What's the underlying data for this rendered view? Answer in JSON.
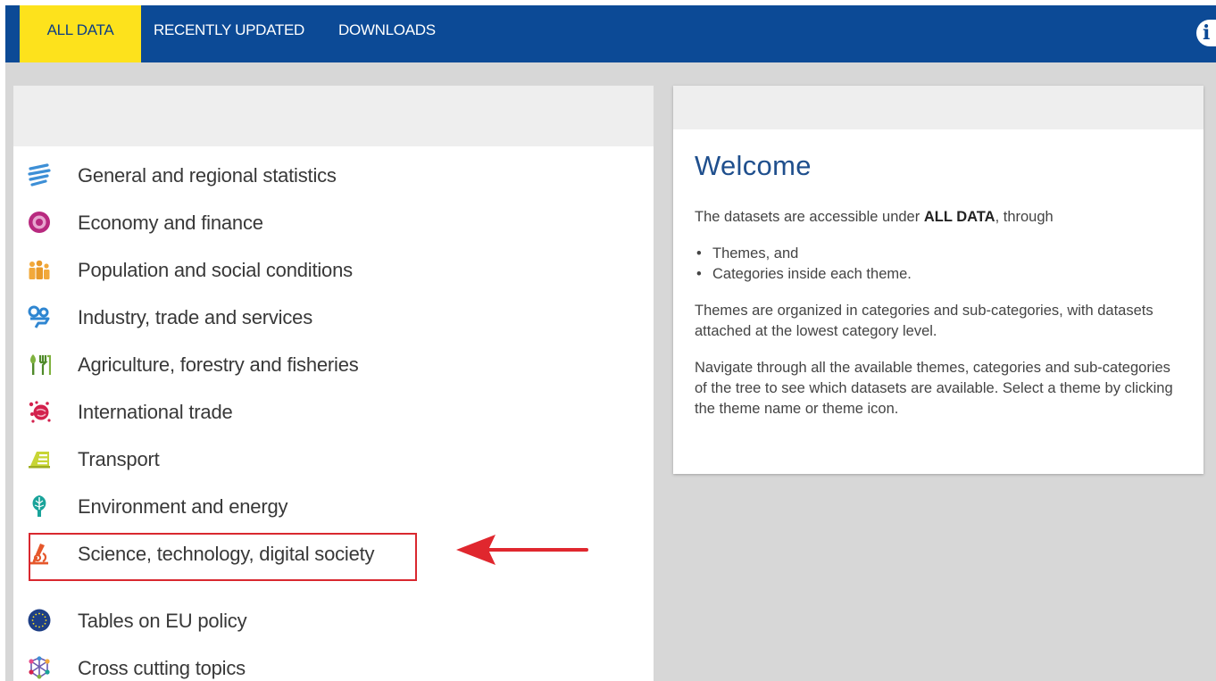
{
  "nav": {
    "tabs": [
      {
        "label": "ALL DATA",
        "active": true
      },
      {
        "label": "RECENTLY UPDATED",
        "active": false
      },
      {
        "label": "DOWNLOADS",
        "active": false
      }
    ],
    "info_icon": "info-icon"
  },
  "themes": {
    "items": [
      {
        "label": "General and regional statistics",
        "icon": "general-statistics-icon"
      },
      {
        "label": "Economy and finance",
        "icon": "economy-finance-icon"
      },
      {
        "label": "Population and social conditions",
        "icon": "population-icon"
      },
      {
        "label": "Industry, trade and services",
        "icon": "industry-icon"
      },
      {
        "label": "Agriculture, forestry and fisheries",
        "icon": "agriculture-icon"
      },
      {
        "label": "International trade",
        "icon": "international-trade-icon"
      },
      {
        "label": "Transport",
        "icon": "transport-icon"
      },
      {
        "label": "Environment and energy",
        "icon": "environment-icon"
      },
      {
        "label": "Science, technology, digital society",
        "icon": "science-icon",
        "highlighted": true
      },
      {
        "label": "Tables on EU policy",
        "icon": "eu-policy-icon"
      },
      {
        "label": "Cross cutting topics",
        "icon": "cross-cutting-icon"
      }
    ]
  },
  "welcome": {
    "title": "Welcome",
    "intro_before": "The datasets are accessible under ",
    "intro_bold": "ALL DATA",
    "intro_after": ", through",
    "bullets": [
      "Themes, and",
      "Categories inside each theme."
    ],
    "paragraph_1": "Themes are organized in categories and sub-categories, with datasets attached at the lowest category level.",
    "paragraph_2": "Navigate through all the available themes, categories and sub-categories of the tree to see which datasets are available. Select a theme by clicking the theme name or theme icon."
  },
  "colors": {
    "nav_background": "#0c4a96",
    "active_tab": "#fde21c",
    "highlight": "#d9282f",
    "welcome_title": "#1f4f8d"
  }
}
